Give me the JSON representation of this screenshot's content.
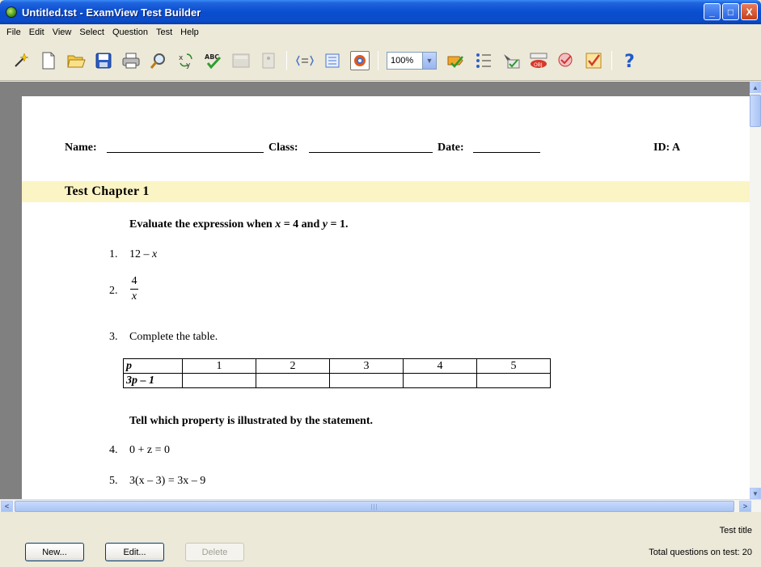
{
  "window": {
    "title": "Untitled.tst - ExamView Test Builder",
    "minimize": "_",
    "maximize": "□",
    "close": "X"
  },
  "menu": [
    "File",
    "Edit",
    "View",
    "Select",
    "Question",
    "Test",
    "Help"
  ],
  "toolbar": {
    "zoom_value": "100%",
    "spell_label": "ABC"
  },
  "page": {
    "header": {
      "name_label": "Name:",
      "class_label": "Class:",
      "date_label": "Date:",
      "id_label": "ID: A"
    },
    "chapter_title": "Test Chapter 1",
    "instruction_1": {
      "prefix": "Evaluate the expression when ",
      "var1": "x",
      "mid1": " = 4 and ",
      "var2": "y",
      "mid2": " = 1."
    },
    "questions": [
      {
        "number": "1.",
        "text": "12 – ",
        "var": "x"
      },
      {
        "number": "2.",
        "numerator": "4",
        "denominator": "x"
      },
      {
        "number": "3.",
        "text": "Complete the table."
      }
    ],
    "table": {
      "header_row": [
        "p",
        "1",
        "2",
        "3",
        "4",
        "5"
      ],
      "second_row_label": "3p – 1"
    },
    "instruction_2": "Tell which property is illustrated by the statement.",
    "questions_b": [
      {
        "number": "4.",
        "text": "0 + z = 0"
      },
      {
        "number": "5.",
        "text": "3(x – 3) = 3x – 9"
      }
    ]
  },
  "bottom": {
    "new_button": "New...",
    "edit_button": "Edit...",
    "delete_button": "Delete",
    "test_title_label": "Test title",
    "total_questions": "Total questions on test: 20"
  }
}
